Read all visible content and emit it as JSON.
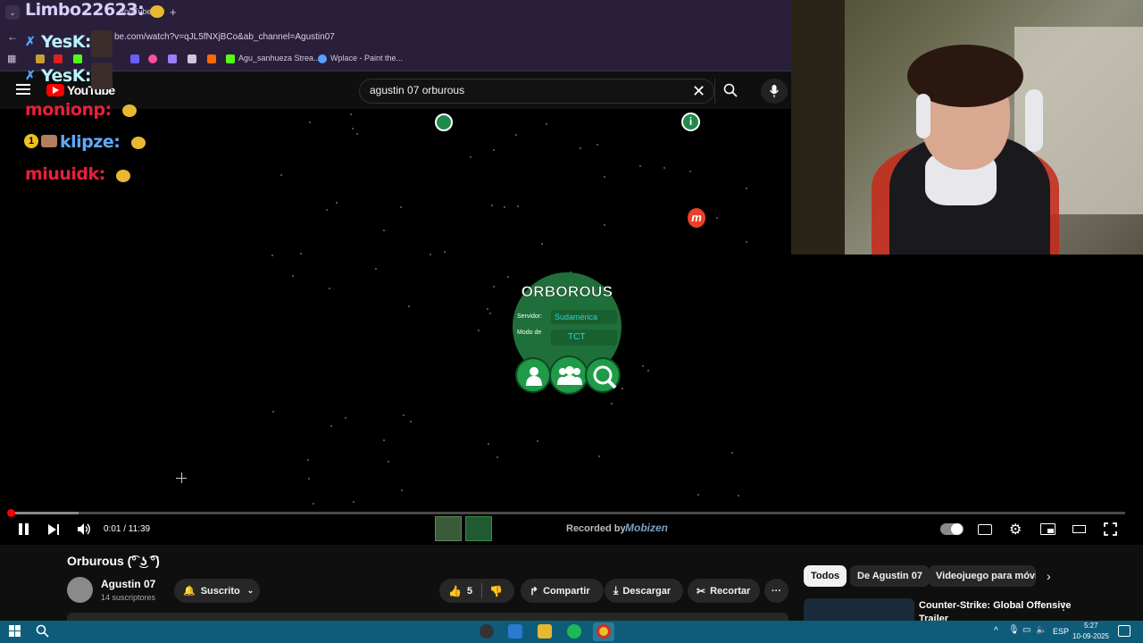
{
  "browser": {
    "tab_title": "YouTube",
    "url": "be.com/watch?v=qJL5fNXjBCo&ab_channel=Agustin07",
    "bookmarks": [
      {
        "label": "Agu_sanhueza Strea..."
      },
      {
        "label": "Wplace - Paint the..."
      }
    ]
  },
  "chat": {
    "messages": [
      {
        "user": "Limbo22623:",
        "color": "#d8d0ff"
      },
      {
        "user": "YesK:",
        "color": "#b8f0ff"
      },
      {
        "user": "YesK:",
        "color": "#b8f0ff"
      },
      {
        "user": "monionp:",
        "color": "#e8203a"
      },
      {
        "user": "klipze:",
        "color": "#5fa8ff"
      },
      {
        "user": "miuuidk:",
        "color": "#e8203a"
      }
    ]
  },
  "youtube": {
    "logo": "YouTube",
    "search_value": "agustin 07 orburous",
    "video_title": "Orburous (͡° ͜ʖ ͡°)",
    "channel_name": "Agustin 07",
    "subscribers": "14 suscriptores",
    "subscribe_label": "Suscrito",
    "likes": "5",
    "share_label": "Compartir",
    "download_label": "Descargar",
    "clip_label": "Recortar",
    "chips": [
      "Todos",
      "De Agustin 07",
      "Videojuego para móvile"
    ],
    "recommended_title_1": "Counter-Strike: Global Offensive",
    "recommended_title_2": "Trailer"
  },
  "player": {
    "time": "0:01 / 11:39",
    "watermark": "Recorded by",
    "watermark_brand": "Mobizen",
    "progress_fraction": 0.0014
  },
  "game": {
    "title": "ORBOROUS",
    "server_label": "Servidor:",
    "server_value": "Sudamérica",
    "mode_label": "Modo de",
    "mode_value": "TCT"
  },
  "taskbar": {
    "time": "5:27",
    "date": "10-09-2025",
    "lang": "ESP"
  },
  "colors": {
    "accent_red": "#ff0000",
    "game_green": "#1f6f3a",
    "chrome_purple": "#2a1f3a",
    "taskbar_blue": "#0e5c7a"
  }
}
